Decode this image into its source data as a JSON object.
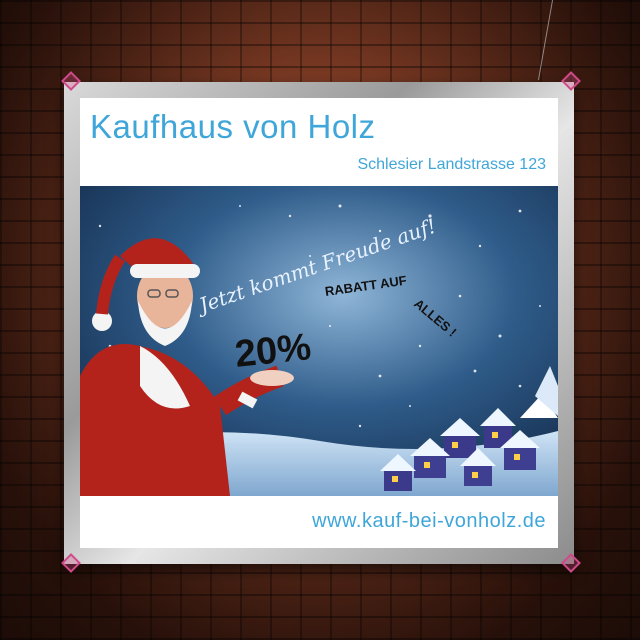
{
  "sign": {
    "store_name": "Kaufhaus von Holz",
    "address": "Schlesier Landstrasse 123",
    "slogan": "Jetzt kommt Freude auf!",
    "discount": "20%",
    "discount_text_1": "RABATT AUF",
    "discount_text_2": "ALLES !",
    "website": "www.kauf-bei-vonholz.de"
  },
  "colors": {
    "brand_blue": "#3fa6d9",
    "santa_red": "#b3231b",
    "night_sky": "#1f3f66"
  }
}
